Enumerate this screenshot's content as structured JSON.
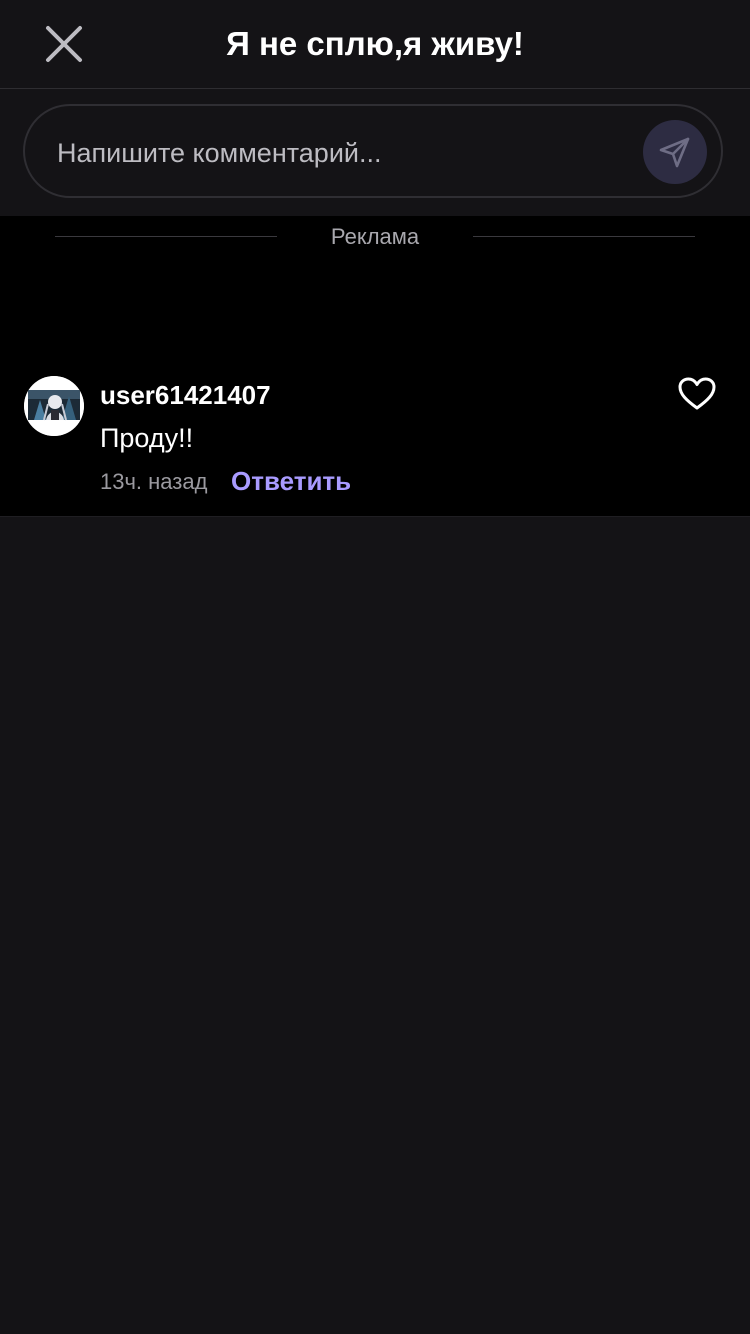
{
  "header": {
    "title": "Я не сплю,я живу!",
    "close_icon": "close-icon"
  },
  "composer": {
    "placeholder": "Напишите комментарий...",
    "value": "",
    "send_icon": "send-icon"
  },
  "ad": {
    "label": "Реклама"
  },
  "comments": [
    {
      "username": "user61421407",
      "text": "Проду!!",
      "time": "13ч. назад",
      "reply_label": "Ответить",
      "like_icon": "heart-outline-icon",
      "avatar_icon": "avatar"
    }
  ],
  "colors": {
    "background": "#141316",
    "content_background": "#000000",
    "accent": "#a99bff",
    "send_button": "#2d2c42"
  }
}
